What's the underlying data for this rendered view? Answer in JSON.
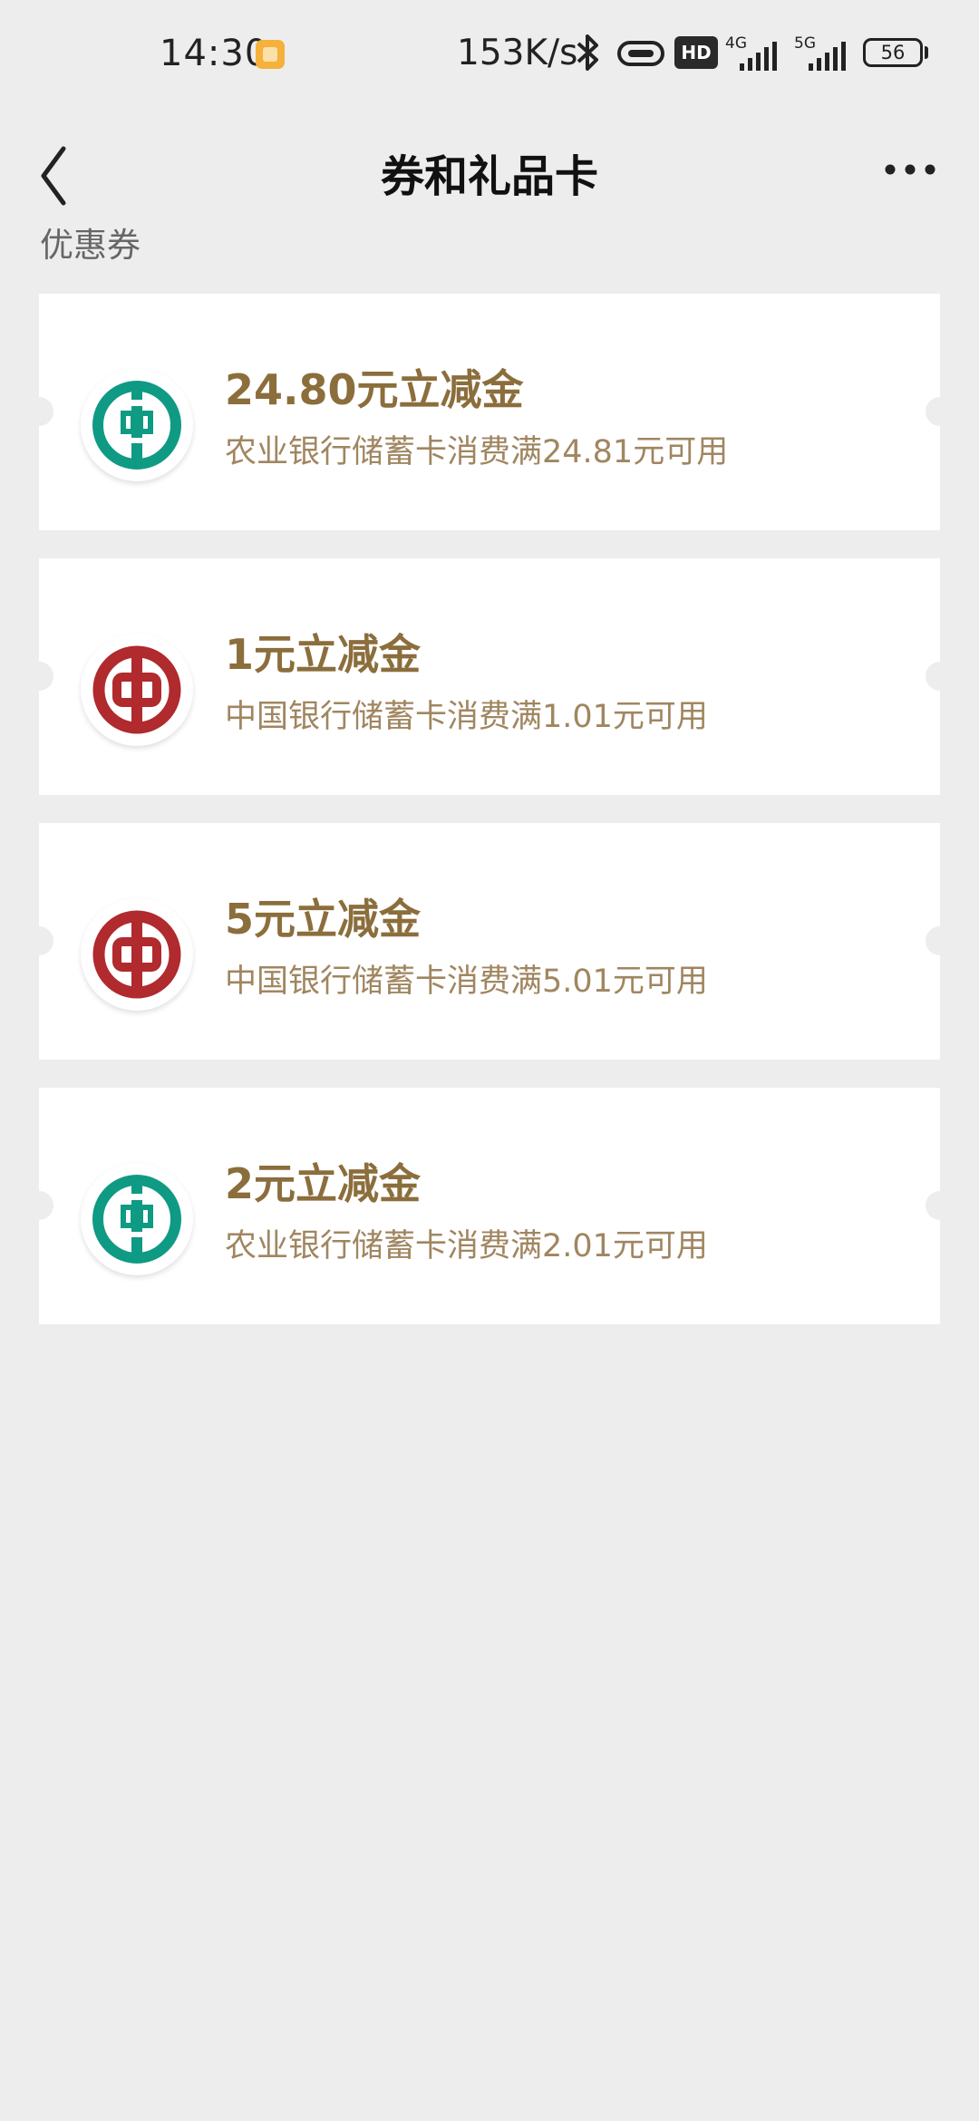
{
  "status_bar": {
    "time": "14:30",
    "net_speed": "153K/s",
    "hd_label": "HD",
    "sim1_label": "4G",
    "sim2_label": "5G",
    "battery": "56"
  },
  "nav": {
    "title": "券和礼品卡"
  },
  "section": {
    "title": "优惠券"
  },
  "colors": {
    "abc_green": "#0f9a84",
    "boc_red": "#b02a2e",
    "amount_gold": "#8b6e3c"
  },
  "coupons": [
    {
      "amount": "24.80元立减金",
      "desc": "农业银行储蓄卡消费满24.81元可用",
      "logo_icon": "abc-bank-logo-icon"
    },
    {
      "amount": "1元立减金",
      "desc": "中国银行储蓄卡消费满1.01元可用",
      "logo_icon": "boc-bank-logo-icon"
    },
    {
      "amount": "5元立减金",
      "desc": "中国银行储蓄卡消费满5.01元可用",
      "logo_icon": "boc-bank-logo-icon"
    },
    {
      "amount": "2元立减金",
      "desc": "农业银行储蓄卡消费满2.01元可用",
      "logo_icon": "abc-bank-logo-icon"
    }
  ]
}
